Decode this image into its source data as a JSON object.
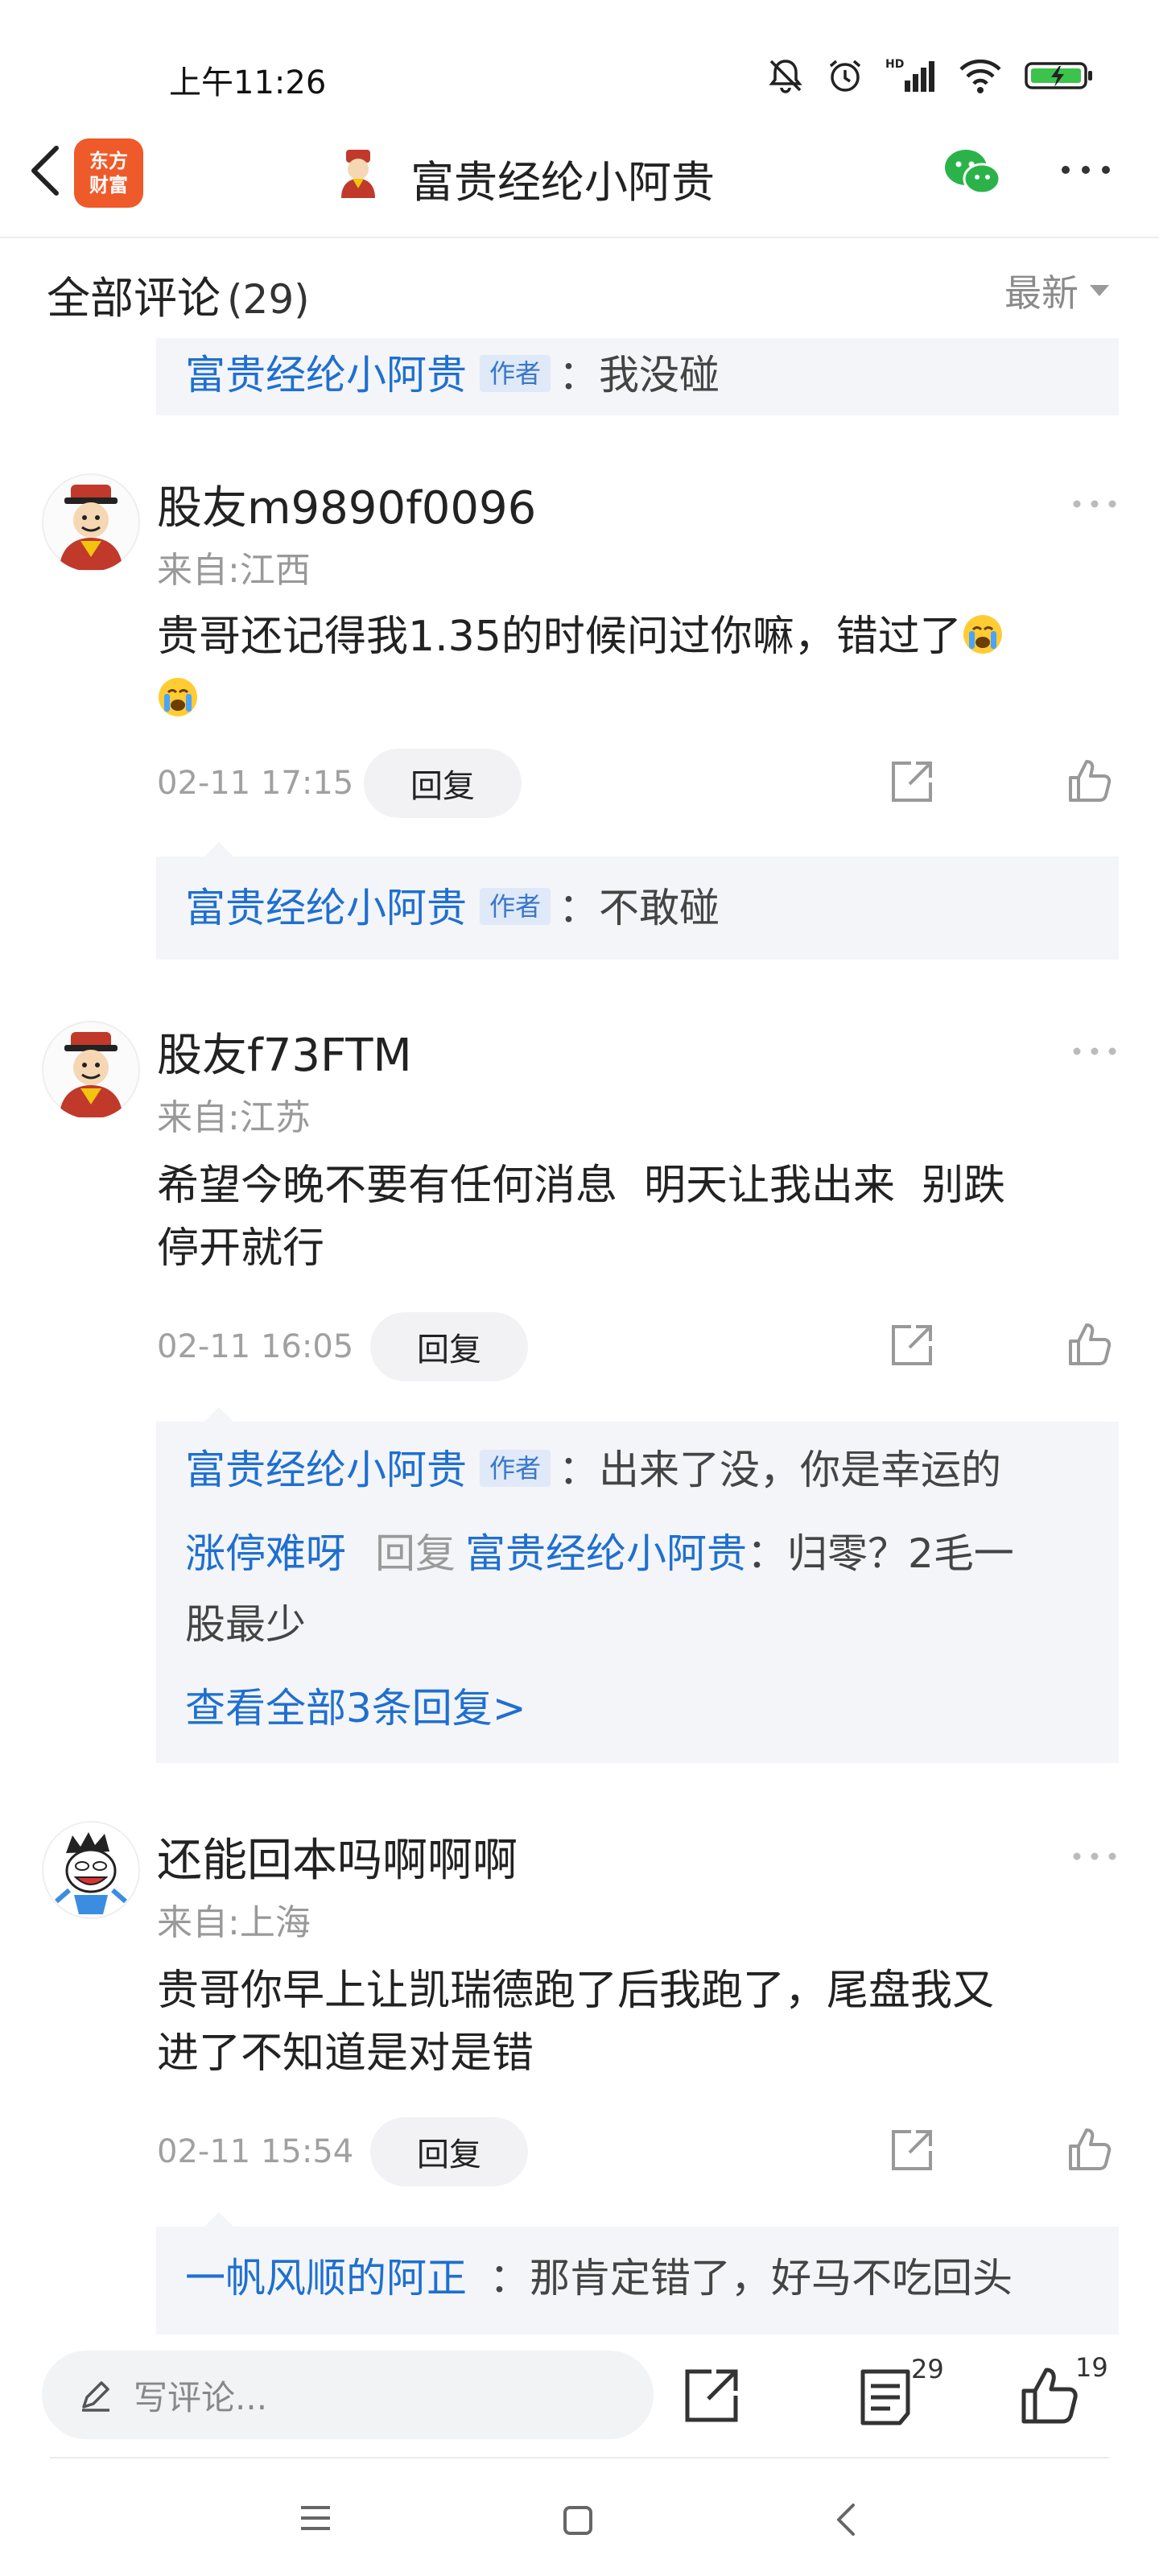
{
  "status_bar": {
    "time": "上午11:26"
  },
  "header": {
    "logo_line1": "东方",
    "logo_line2": "财富",
    "title": "富贵经纶小阿贵"
  },
  "comments_header": {
    "title": "全部评论",
    "count": "(29)",
    "sort": "最新"
  },
  "author_tag": "作者",
  "reply_label": "回复",
  "top_reply": {
    "name": "富贵经纶小阿贵",
    "text": "：我没碰"
  },
  "comments": [
    {
      "user": "股友m9890f0096",
      "location": "来自:江西",
      "text_line1": "贵哥还记得我1.35的时候问过你嘛，错过了",
      "time": "02-11 17:15",
      "reply": {
        "name": "富贵经纶小阿贵",
        "text": "：不敢碰"
      }
    },
    {
      "user": "股友f73FTM",
      "location": "来自:江苏",
      "text_line1": "希望今晚不要有任何消息  明天让我出来  别跌",
      "text_line2": "停开就行",
      "time": "02-11 16:05",
      "replies": [
        {
          "name": "富贵经纶小阿贵",
          "text": "：出来了没，你是幸运的"
        },
        {
          "name": "涨停难呀",
          "reply_word": "回复",
          "target": "富贵经纶小阿贵",
          "text": "：归零？2毛一",
          "text2": "股最少"
        }
      ],
      "view_all": "查看全部3条回复>"
    },
    {
      "user": "还能回本吗啊啊啊",
      "location": "来自:上海",
      "text_line1": "贵哥你早上让凯瑞德跑了后我跑了，尾盘我又",
      "text_line2": "进了不知道是对是错",
      "time": "02-11 15:54",
      "reply": {
        "name": "一帆风顺的阿正",
        "text": "：那肯定错了，好马不吃回头"
      }
    }
  ],
  "bottom_bar": {
    "input_placeholder": "写评论...",
    "comment_count": "29",
    "like_count": "19"
  },
  "colors": {
    "link_blue": "#1f6fd0",
    "brand_orange": "#ef5a2a",
    "wechat_green": "#2bb34a"
  }
}
